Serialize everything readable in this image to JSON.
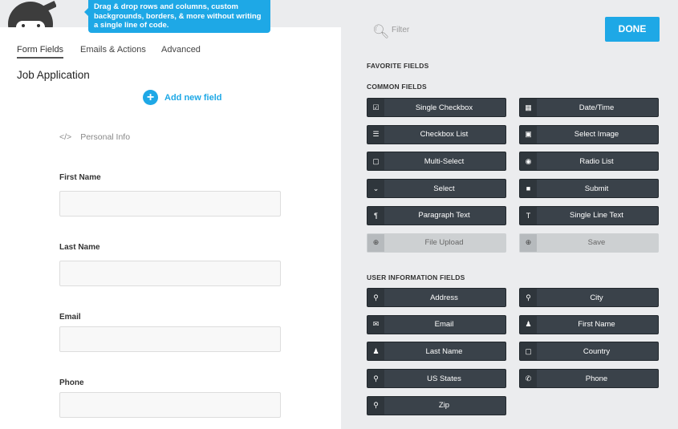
{
  "tooltip": "Drag & drop rows and columns, custom backgrounds, borders, & more without writing a single line of code.",
  "tabs": [
    "Form Fields",
    "Emails & Actions",
    "Advanced"
  ],
  "form_title": "Job Application",
  "add_field": "Add new field",
  "section": {
    "icon": "</>",
    "label": "Personal Info"
  },
  "fields": [
    {
      "label": "First Name",
      "value": ""
    },
    {
      "label": "Last Name",
      "value": ""
    },
    {
      "label": "Email",
      "value": ""
    },
    {
      "label": "Phone",
      "value": ""
    }
  ],
  "filter_placeholder": "Filter",
  "done": "DONE",
  "favorite_header": "FAVORITE FIELDS",
  "common_header": "COMMON FIELDS",
  "user_header": "USER INFORMATION FIELDS",
  "colors": {
    "accent": "#1ea8e6",
    "button": "#3a424a"
  },
  "common_fields": [
    {
      "label": "Single Checkbox",
      "icon": "checkbox-icon",
      "glyph": "☑"
    },
    {
      "label": "Date/Time",
      "icon": "calendar-icon",
      "glyph": "▦"
    },
    {
      "label": "Checkbox List",
      "icon": "list-icon",
      "glyph": "☰"
    },
    {
      "label": "Select Image",
      "icon": "image-icon",
      "glyph": "▣"
    },
    {
      "label": "Multi-Select",
      "icon": "square-icon",
      "glyph": "▢"
    },
    {
      "label": "Radio List",
      "icon": "radio-icon",
      "glyph": "◉"
    },
    {
      "label": "Select",
      "icon": "chevron-down-icon",
      "glyph": "⌄"
    },
    {
      "label": "Submit",
      "icon": "square-filled-icon",
      "glyph": "■"
    },
    {
      "label": "Paragraph Text",
      "icon": "paragraph-icon",
      "glyph": "¶"
    },
    {
      "label": "Single Line Text",
      "icon": "text-icon",
      "glyph": "T"
    },
    {
      "label": "File Upload",
      "icon": "upload-icon",
      "glyph": "⊕",
      "disabled": true
    },
    {
      "label": "Save",
      "icon": "save-icon",
      "glyph": "⊕",
      "disabled": true
    }
  ],
  "user_fields": [
    {
      "label": "Address",
      "icon": "map-pin-icon",
      "glyph": "⚲"
    },
    {
      "label": "City",
      "icon": "map-pin-icon",
      "glyph": "⚲"
    },
    {
      "label": "Email",
      "icon": "envelope-icon",
      "glyph": "✉"
    },
    {
      "label": "First Name",
      "icon": "user-icon",
      "glyph": "♟"
    },
    {
      "label": "Last Name",
      "icon": "user-icon",
      "glyph": "♟"
    },
    {
      "label": "Country",
      "icon": "square-icon",
      "glyph": "▢"
    },
    {
      "label": "US States",
      "icon": "map-pin-icon",
      "glyph": "⚲"
    },
    {
      "label": "Phone",
      "icon": "phone-icon",
      "glyph": "✆"
    },
    {
      "label": "Zip",
      "icon": "map-pin-icon",
      "glyph": "⚲"
    }
  ]
}
